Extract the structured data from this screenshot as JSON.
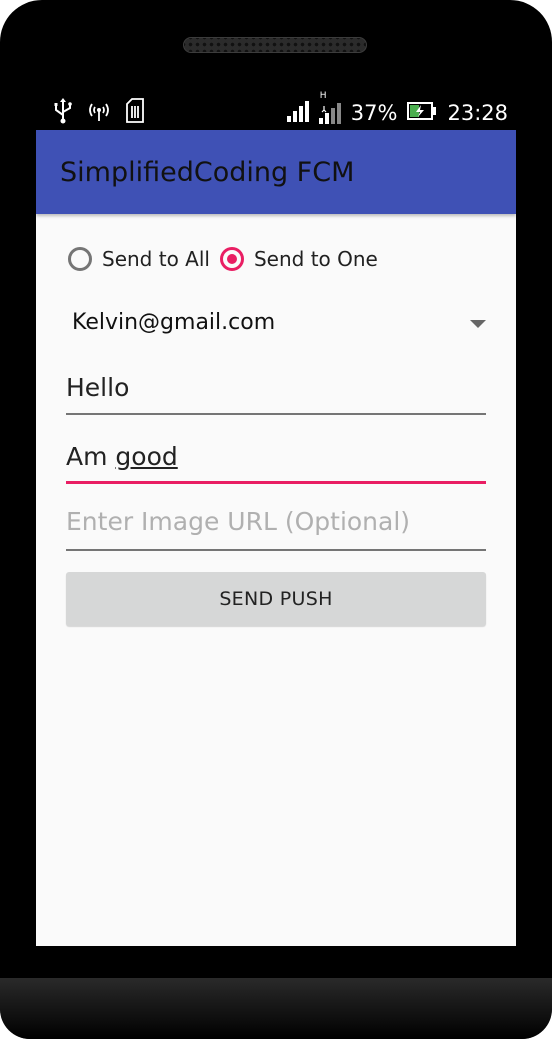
{
  "status_bar": {
    "battery_percent": "37%",
    "time": "23:28",
    "network_type": "H",
    "icons": [
      "usb-icon",
      "hotspot-icon",
      "sim-icon",
      "signal-icon",
      "signal-h-icon",
      "battery-charging-icon"
    ]
  },
  "app_bar": {
    "title": "SimplifiedCoding FCM",
    "color": "#3f51b5"
  },
  "form": {
    "radio_send_all": "Send to All",
    "radio_send_one": "Send to One",
    "selected_radio": "Send to One",
    "recipient_selected": "Kelvin@gmail.com",
    "title_value": "Hello",
    "message_prefix": "Am ",
    "message_underlined": "good",
    "image_url_placeholder": "Enter Image URL (Optional)",
    "image_url_value": "",
    "send_button": "SEND PUSH"
  },
  "colors": {
    "accent": "#e91e63",
    "background": "#fafafa",
    "button": "#d6d7d7"
  }
}
